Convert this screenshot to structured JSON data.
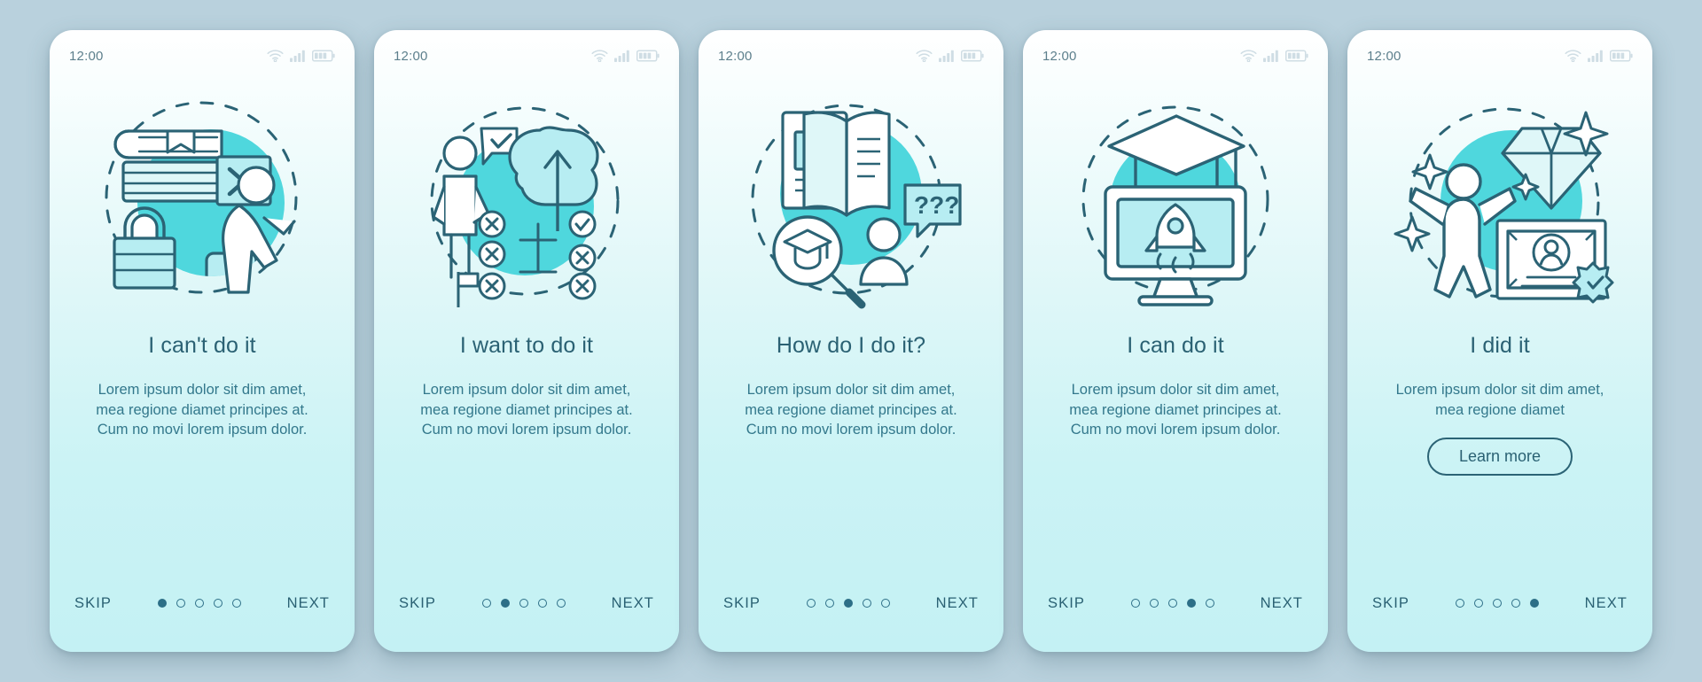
{
  "theme": {
    "page_background": "#b9d1dd",
    "card_gradient_top": "#ffffff",
    "card_gradient_bottom": "#c4f1f4",
    "accent_cyan": "#4fd7dd",
    "line_dark": "#2b6375",
    "title_color": "#2a6173",
    "body_color": "#33788c",
    "status_text_color": "#5d7f8c"
  },
  "status_bar": {
    "time": "12:00",
    "icons": [
      "wifi-icon",
      "cellular-signal-icon",
      "battery-icon"
    ]
  },
  "common": {
    "skip_label": "SKIP",
    "next_label": "NEXT",
    "total_steps": 5
  },
  "screens": [
    {
      "id": "screen-1",
      "illustration": "books-lock-seated-person",
      "title": "I can't do it",
      "body": "Lorem ipsum dolor sit dim amet, mea regione diamet principes at. Cum no movi lorem ipsum dolor.",
      "active_step": 1,
      "cta": null
    },
    {
      "id": "screen-2",
      "illustration": "person-brain-flowchart",
      "title": "I want to do it",
      "body": "Lorem ipsum dolor sit dim amet, mea regione diamet principes at. Cum no movi lorem ipsum dolor.",
      "active_step": 2,
      "cta": null
    },
    {
      "id": "screen-3",
      "illustration": "open-book-magnifier-question",
      "title": "How do I do it?",
      "body": "Lorem ipsum dolor sit dim amet, mea regione diamet principes at. Cum no movi lorem ipsum dolor.",
      "active_step": 3,
      "cta": null
    },
    {
      "id": "screen-4",
      "illustration": "graduation-cap-monitor-rocket",
      "title": "I can do it",
      "body": "Lorem ipsum dolor sit dim amet, mea regione diamet principes at. Cum no movi lorem ipsum dolor.",
      "active_step": 4,
      "cta": null
    },
    {
      "id": "screen-5",
      "illustration": "diamond-certificate-celebrating-person",
      "title": "I did it",
      "body": "Lorem ipsum dolor sit dim amet, mea regione diamet",
      "active_step": 5,
      "cta": "Learn more"
    }
  ]
}
